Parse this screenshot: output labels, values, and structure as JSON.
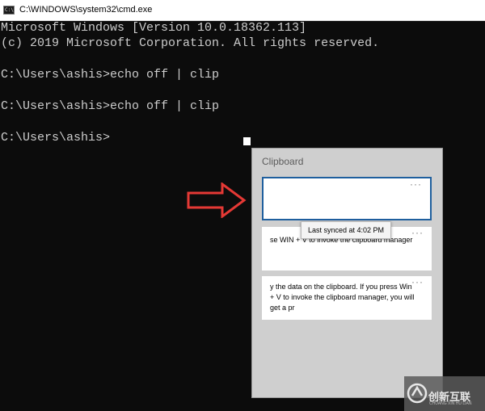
{
  "window": {
    "title": "C:\\WINDOWS\\system32\\cmd.exe",
    "icon": "cmd-icon"
  },
  "console": {
    "lines": [
      "Microsoft Windows [Version 10.0.18362.113]",
      "(c) 2019 Microsoft Corporation. All rights reserved.",
      "",
      "C:\\Users\\ashis>echo off | clip",
      "",
      "C:\\Users\\ashis>echo off | clip",
      "",
      "C:\\Users\\ashis>"
    ],
    "text_color": "#cccccc",
    "background": "#0c0c0c"
  },
  "clipboard": {
    "title": "Clipboard",
    "items": [
      {
        "text": "",
        "menu": "···",
        "selected": true
      },
      {
        "text": "se WIN + V to invoke the clipboard manager",
        "menu": "···"
      },
      {
        "text": "y the data on the clipboard. If you press Win + V to invoke the clipboard manager, you will get a pr",
        "menu": "···"
      }
    ],
    "tooltip": "Last synced at 4:02 PM",
    "accent": "#1f5f9e"
  },
  "annotation": {
    "arrow_color": "#e53935",
    "icon": "red-arrow-right-icon"
  },
  "watermark": {
    "text": "创新互联",
    "subtext": "CHUANG XIN HU LIAN"
  }
}
